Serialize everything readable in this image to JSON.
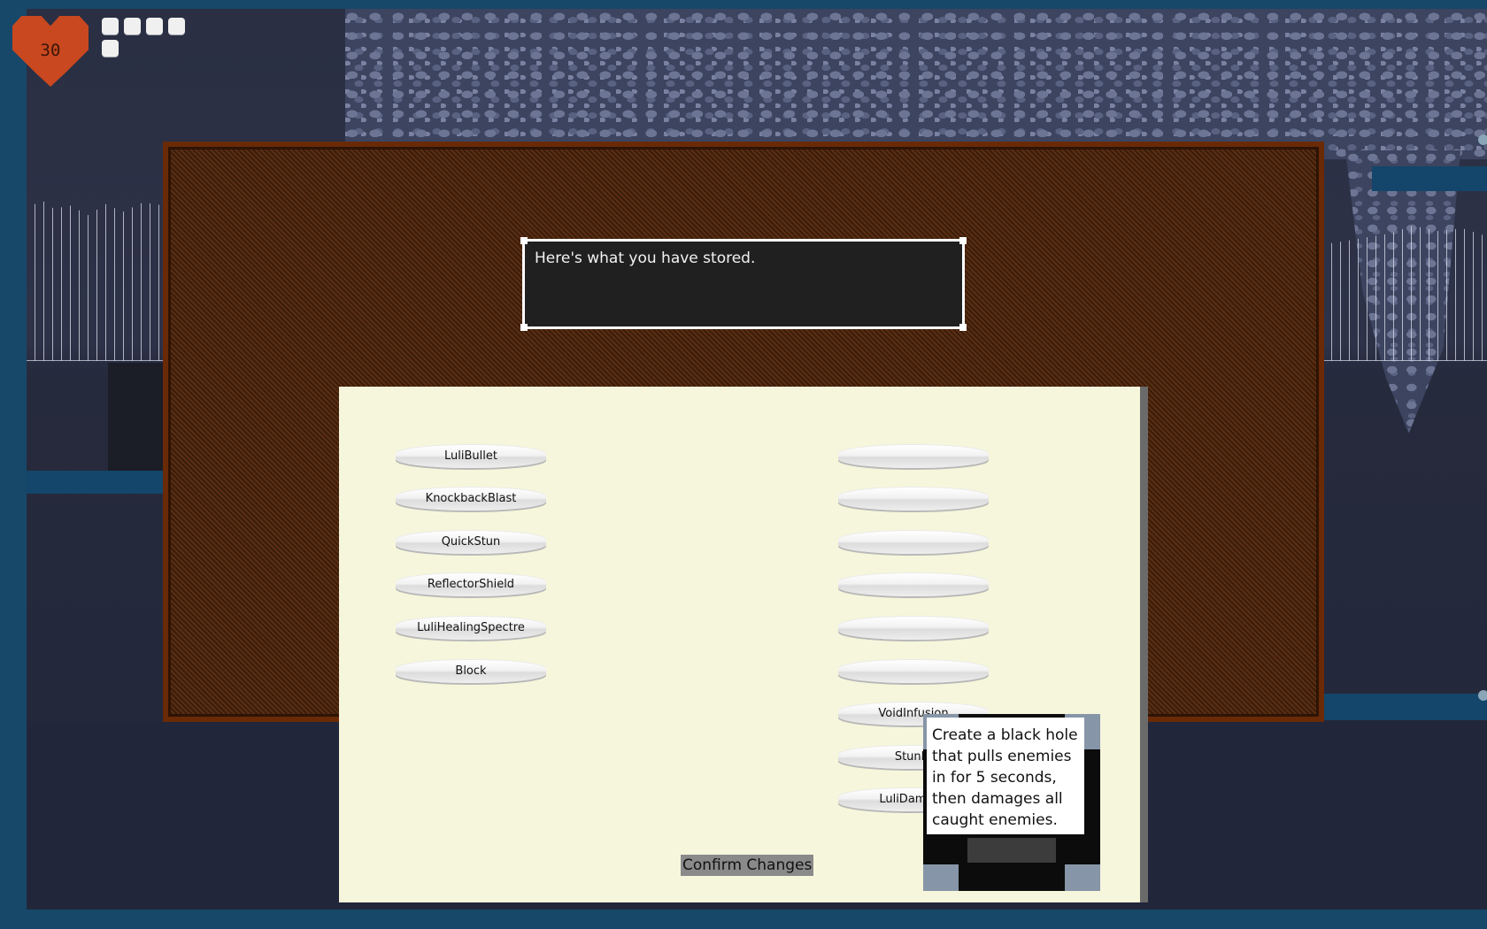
{
  "hud": {
    "health_value": "30",
    "pips_total": 5
  },
  "dialog": {
    "text": "Here's what you have stored."
  },
  "inventory": {
    "left_column": [
      "LuliBullet",
      "KnockbackBlast",
      "QuickStun",
      "ReflectorShield",
      "LuliHealingSpectre",
      "Block"
    ],
    "right_column": [
      "",
      "",
      "",
      "",
      "",
      "",
      "VoidInfusion",
      "StunBl",
      "LuliDamage"
    ],
    "confirm_label": "Confirm Changes"
  },
  "tooltip": {
    "text": "Create a black hole that pulls enemies in for 5 seconds, then damages all caught enemies."
  },
  "colors": {
    "heart": "#c9481f",
    "menu_background": "#4a2610",
    "panel_background": "#f6f6dc",
    "confirm_button": "#8a8a8a",
    "dialog_background": "#202020"
  }
}
